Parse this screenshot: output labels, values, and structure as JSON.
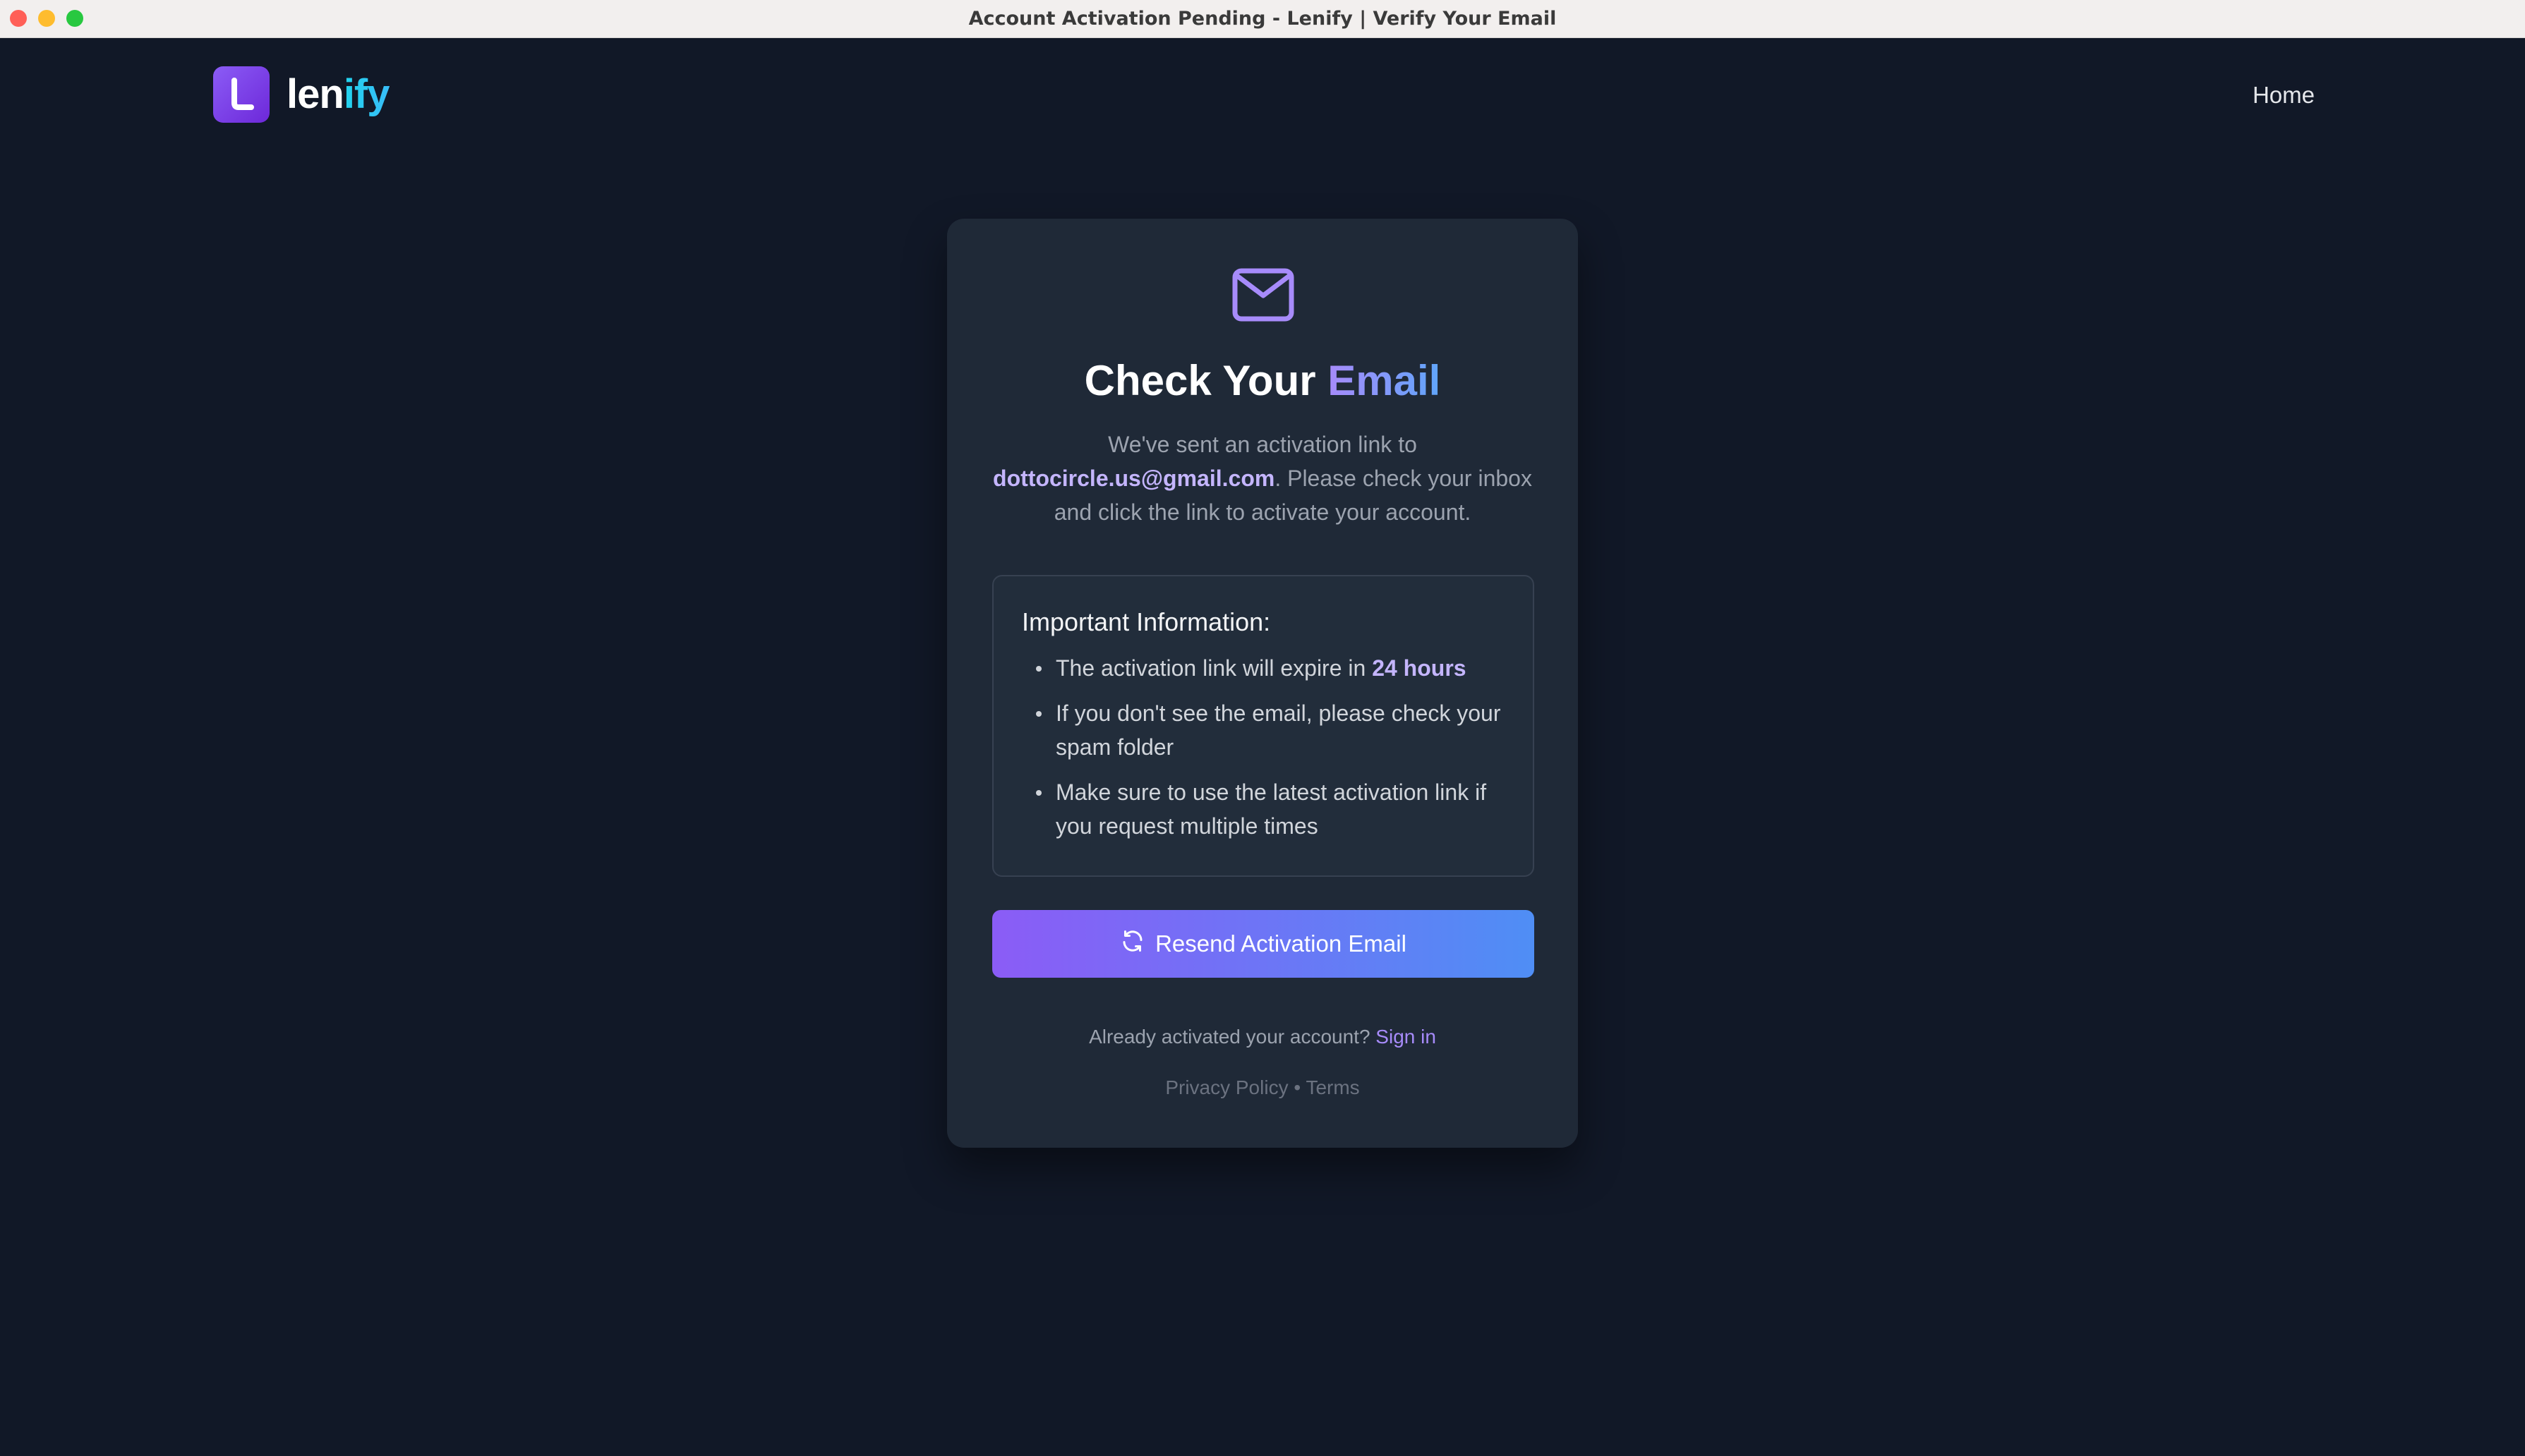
{
  "window": {
    "title": "Account Activation Pending - Lenify | Verify Your Email"
  },
  "header": {
    "logo_part1": "len",
    "logo_part2": "ify",
    "nav_home": "Home"
  },
  "card": {
    "title_prefix": "Check Your",
    "title_highlight": "Email",
    "desc_line1": "We've sent an activation link to",
    "email": "dottocircle.us@gmail.com",
    "desc_after_email": ". Please check your inbox and click the link to activate your account.",
    "info": {
      "title": "Important Information:",
      "item1_prefix": "The activation link will expire in",
      "item1_highlight": "24 hours",
      "item2": "If you don't see the email, please check your spam folder",
      "item3": "Make sure to use the latest activation link if you request multiple times"
    },
    "resend_button": "Resend Activation Email",
    "signin_prompt": "Already activated your account?",
    "signin_link": "Sign in",
    "footer": {
      "privacy": "Privacy Policy",
      "separator": "•",
      "terms": "Terms"
    }
  },
  "colors": {
    "background": "#111827",
    "card": "#1f2937",
    "accent_purple": "#8b5cf6",
    "accent_blue": "#4f8ef5",
    "link": "#a78bfa"
  }
}
